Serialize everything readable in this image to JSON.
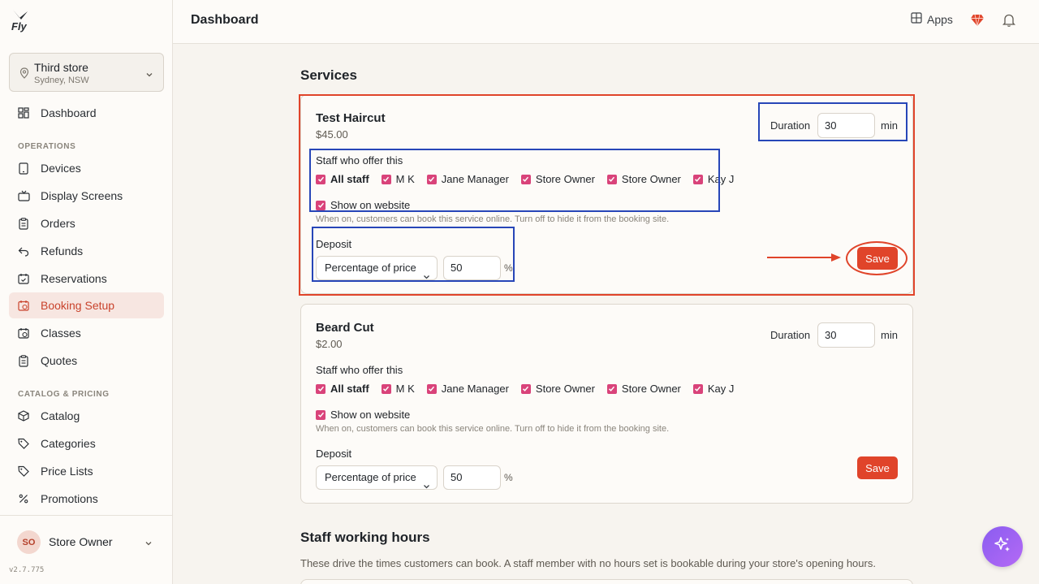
{
  "app": {
    "logo_text": "Fly",
    "version": "v2.7.775"
  },
  "store": {
    "name": "Third store",
    "location": "Sydney, NSW"
  },
  "nav": {
    "dashboard": "Dashboard",
    "operations_label": "OPERATIONS",
    "operations": [
      "Devices",
      "Display Screens",
      "Orders",
      "Refunds",
      "Reservations",
      "Booking Setup",
      "Classes",
      "Quotes"
    ],
    "catalog_label": "CATALOG & PRICING",
    "catalog": [
      "Catalog",
      "Categories",
      "Price Lists",
      "Promotions"
    ],
    "active": "Booking Setup"
  },
  "user": {
    "initials": "SO",
    "name": "Store Owner"
  },
  "topbar": {
    "title": "Dashboard",
    "apps_label": "Apps"
  },
  "services": {
    "heading": "Services",
    "items": [
      {
        "name": "Test Haircut",
        "price": "$45.00",
        "duration_label": "Duration",
        "duration": "30",
        "duration_unit": "min",
        "staff_label": "Staff who offer this",
        "staff": [
          "All staff",
          "M K",
          "Jane Manager",
          "Store Owner",
          "Store Owner",
          "Kay J"
        ],
        "website_label": "Show on website",
        "website_help": "When on, customers can book this service online. Turn off to hide it from the booking site.",
        "deposit_label": "Deposit",
        "deposit_type": "Percentage of price",
        "deposit_value": "50",
        "deposit_unit": "%",
        "save_label": "Save"
      },
      {
        "name": "Beard Cut",
        "price": "$2.00",
        "duration_label": "Duration",
        "duration": "30",
        "duration_unit": "min",
        "staff_label": "Staff who offer this",
        "staff": [
          "All staff",
          "M K",
          "Jane Manager",
          "Store Owner",
          "Store Owner",
          "Kay J"
        ],
        "website_label": "Show on website",
        "website_help": "When on, customers can book this service online. Turn off to hide it from the booking site.",
        "deposit_label": "Deposit",
        "deposit_type": "Percentage of price",
        "deposit_value": "50",
        "deposit_unit": "%",
        "save_label": "Save"
      }
    ]
  },
  "staff_hours": {
    "heading": "Staff working hours",
    "description": "These drive the times customers can book. A staff member with no hours set is bookable during your store's opening hours."
  },
  "colors": {
    "accent": "#e0442a",
    "checkbox": "#d9437a",
    "annotation_blue": "#2746b8",
    "fab": "#9b63f3"
  }
}
